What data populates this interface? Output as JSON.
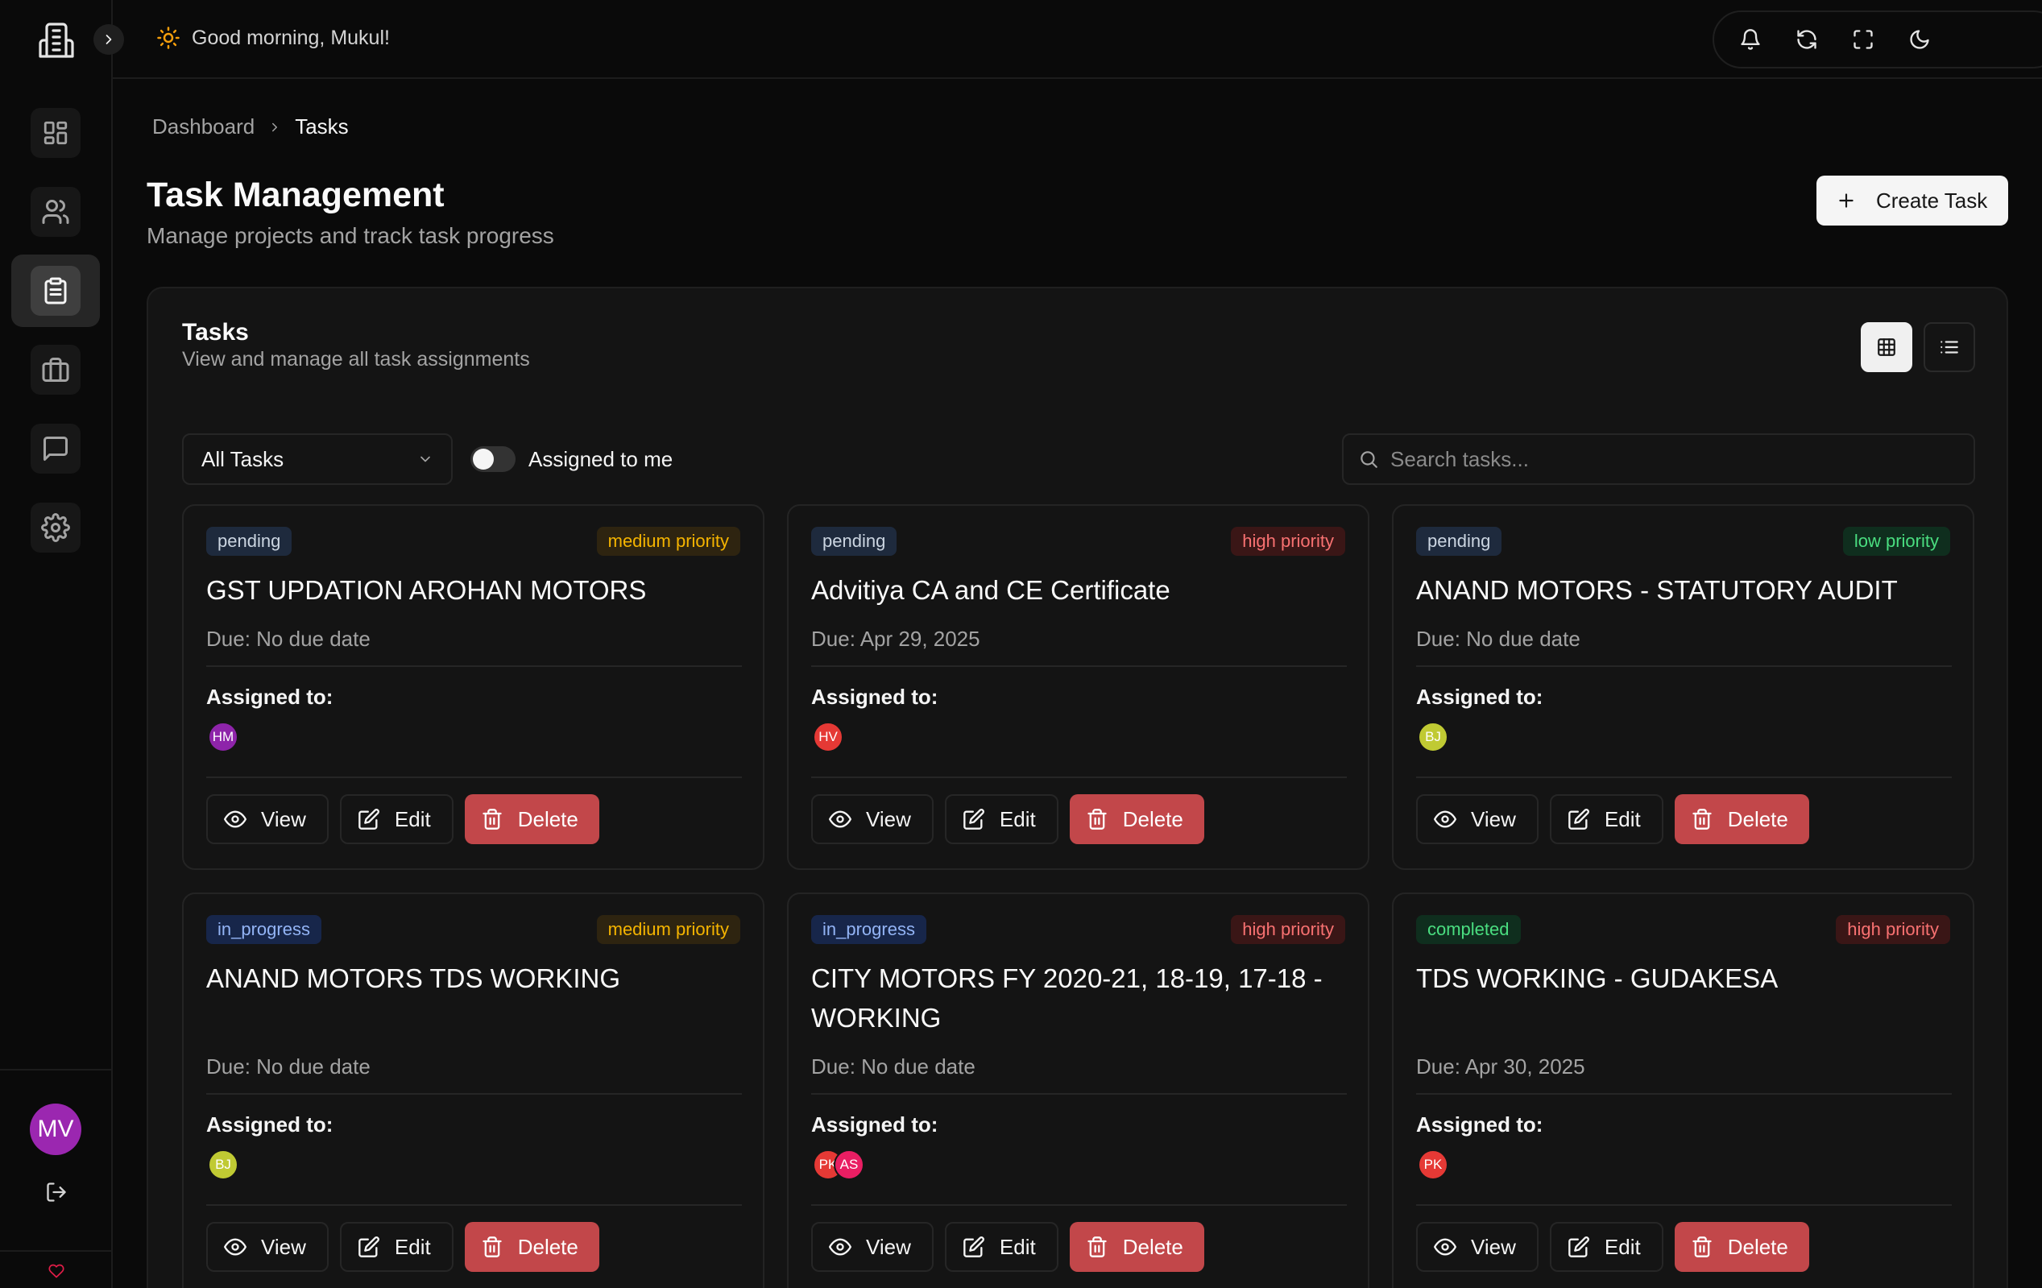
{
  "topbar": {
    "greeting": "Good morning, Mukul!",
    "avatar_initials": "MV",
    "icons": [
      "bell-icon",
      "refresh-icon",
      "fullscreen-icon",
      "moon-icon"
    ]
  },
  "sidebar": {
    "items": [
      {
        "name": "dashboard",
        "icon": "dashboard-icon"
      },
      {
        "name": "users",
        "icon": "users-icon"
      },
      {
        "name": "tasks",
        "icon": "clipboard-icon",
        "active": true
      },
      {
        "name": "projects",
        "icon": "briefcase-icon"
      },
      {
        "name": "messages",
        "icon": "chat-icon"
      },
      {
        "name": "settings",
        "icon": "gear-icon"
      }
    ],
    "avatar_initials": "MV"
  },
  "breadcrumb": {
    "parent": "Dashboard",
    "current": "Tasks"
  },
  "page": {
    "title": "Task Management",
    "subtitle": "Manage projects and track task progress",
    "create_label": "Create Task"
  },
  "panel": {
    "title": "Tasks",
    "subtitle": "View and manage all task assignments",
    "filter_value": "All Tasks",
    "toggle_label": "Assigned to me",
    "search_placeholder": "Search tasks..."
  },
  "labels": {
    "assigned": "Assigned to:",
    "view": "View",
    "edit": "Edit",
    "delete": "Delete"
  },
  "colors": {
    "accent": "#9b27b0",
    "danger": "#c2474a"
  },
  "tasks": [
    {
      "status": "pending",
      "priority": "medium priority",
      "title": "GST UPDATION AROHAN MOTORS",
      "due": "Due: No due date",
      "assignees": [
        {
          "initials": "HM",
          "color": "#8e24aa"
        }
      ]
    },
    {
      "status": "pending",
      "priority": "high priority",
      "title": "Advitiya CA and CE Certificate",
      "due": "Due: Apr 29, 2025",
      "assignees": [
        {
          "initials": "HV",
          "color": "#e53935"
        }
      ]
    },
    {
      "status": "pending",
      "priority": "low priority",
      "title": "ANAND MOTORS - STATUTORY AUDIT",
      "due": "Due: No due date",
      "assignees": [
        {
          "initials": "BJ",
          "color": "#c0ca33"
        }
      ]
    },
    {
      "status": "in_progress",
      "priority": "medium priority",
      "title": "ANAND MOTORS TDS WORKING",
      "due": "Due: No due date",
      "assignees": [
        {
          "initials": "BJ",
          "color": "#c0ca33"
        }
      ]
    },
    {
      "status": "in_progress",
      "priority": "high priority",
      "title": "CITY MOTORS FY 2020-21, 18-19, 17-18 - WORKING",
      "due": "Due: No due date",
      "assignees": [
        {
          "initials": "PK",
          "color": "#e53935"
        },
        {
          "initials": "AS",
          "color": "#e91e63"
        }
      ]
    },
    {
      "status": "completed",
      "priority": "high priority",
      "title": "TDS WORKING - GUDAKESA",
      "due": "Due: Apr 30, 2025",
      "assignees": [
        {
          "initials": "PK",
          "color": "#e53935"
        }
      ]
    }
  ]
}
